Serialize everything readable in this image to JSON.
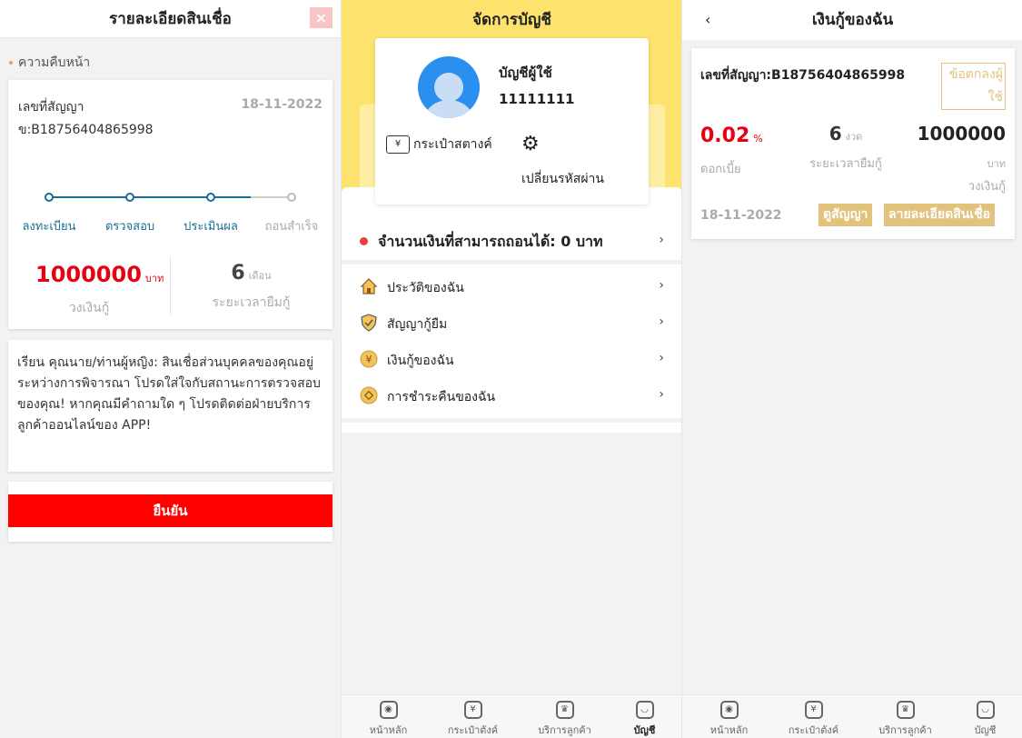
{
  "left": {
    "title": "รายละเอียดสินเชื่อ",
    "close": "×",
    "progress_label": "ความคืบหน้า",
    "contract_text": "เลขที่สัญญา ข:B18756404865998",
    "date": "18-11-2022",
    "steps": [
      "ลงทะเบียน",
      "ตรวจสอบ",
      "ประเมินผล",
      "ถอนสำเร็จ"
    ],
    "step_done": 3,
    "amount": "1000000",
    "amount_unit": "บาท",
    "amount_label": "วงเงินกู้",
    "term": "6",
    "term_unit": "เดือน",
    "term_label": "ระยะเวลายืมกู้",
    "notice": "เรียน คุณนาย/ท่านผู้หญิง: สินเชื่อส่วนบุคคลของคุณอยู่ระหว่างการพิจารณา โปรดใส่ใจกับสถานะการตรวจสอบของคุณ! หากคุณมีคำถามใด ๆ โปรดติดต่อฝ่ายบริการลูกค้าออนไลน์ของ APP!",
    "confirm": "ยืนยัน"
  },
  "middle": {
    "title": "จัดการบัญชี",
    "account_label": "บัญชีผู้ใช้",
    "account_number": "11111111",
    "wallet": "กระเป๋าสตางค์",
    "wallet_icon": "¥",
    "change_password": "เปลี่ยนรหัสผ่าน",
    "withdraw_text": "จำนวนเงินที่สามารถถอนได้: 0 บาท",
    "menu": [
      {
        "label": "ประวัติของฉัน",
        "icon": "house-icon"
      },
      {
        "label": "สัญญากู้ยืม",
        "icon": "shield-icon"
      },
      {
        "label": "เงินกู้ของฉัน",
        "icon": "yen-coin-icon"
      },
      {
        "label": "การชำระคืนของฉัน",
        "icon": "coin-icon"
      }
    ]
  },
  "right": {
    "title": "เงินกู้ของฉัน",
    "back": "‹",
    "contract": "เลขที่สัญญา:B18756404865998",
    "agreement": "ข้อตกลงผู้ใช้",
    "rate": "0.02",
    "rate_unit": "%",
    "rate_label": "ดอกเบี้ย",
    "term": "6",
    "term_unit": "งวด",
    "term_label": "ระยะเวลายืมกู้",
    "amount": "1000000",
    "amount_unit": "บาท",
    "amount_label": "วงเงินกู้",
    "date": "18-11-2022",
    "view_contract": "ดูสัญญา",
    "loan_details": "ลายละเอียดสินเชื่อ"
  },
  "tabs": [
    {
      "label": "หน้าหลัก",
      "icon": "home-icon",
      "glyph": "◉"
    },
    {
      "label": "กระเป๋าตังค์",
      "icon": "wallet-icon",
      "glyph": "¥"
    },
    {
      "label": "บริการลูกค้า",
      "icon": "crown-icon",
      "glyph": "♛"
    },
    {
      "label": "บัญชี",
      "icon": "account-icon",
      "glyph": "◡"
    }
  ],
  "colors": {
    "accent_yellow": "#fde26e",
    "gold": "#e3c27c",
    "red": "#ff0000",
    "step_blue": "#1a6d94"
  }
}
